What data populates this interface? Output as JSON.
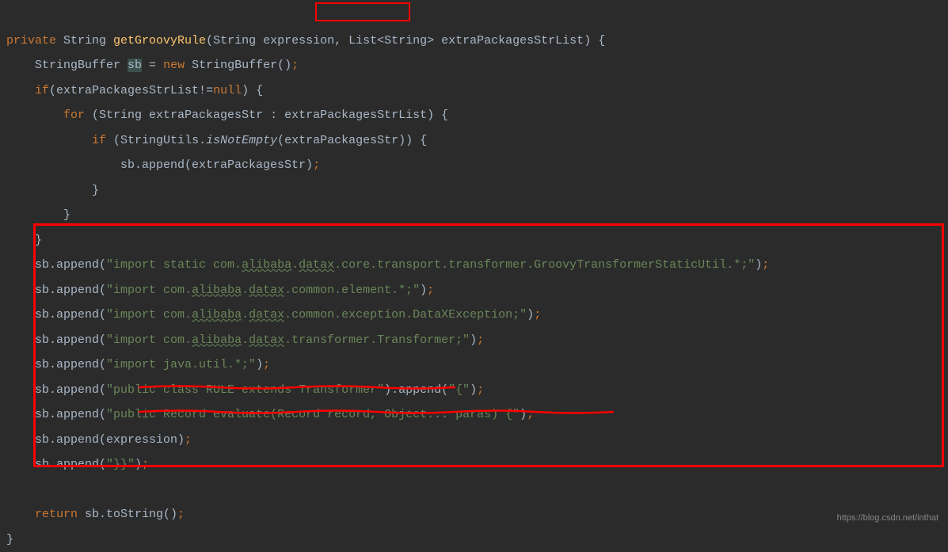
{
  "code": {
    "l1_private": "private",
    "l1_type1": " String ",
    "l1_method": "getGroovyRule",
    "l1_p1": "(",
    "l1_type2": "String ",
    "l1_param1": "expression",
    "l1_comma": ", ",
    "l1_type3": "List<String> extraPackagesStrList",
    "l1_p2": ") {",
    "l2_pre": "    StringBuffer ",
    "l2_var": "sb",
    "l2_eq": " = ",
    "l2_new": "new",
    "l2_post": " StringBuffer()",
    "l2_semi": ";",
    "l3_pre": "    ",
    "l3_if": "if",
    "l3_cond1": "(extraPackagesStrList!=",
    "l3_null": "null",
    "l3_cond2": ") {",
    "l4_pre": "        ",
    "l4_for": "for",
    "l4_post": " (String extraPackagesStr : extraPackagesStrList) {",
    "l5_pre": "            ",
    "l5_if": "if",
    "l5_p1": " (StringUtils.",
    "l5_method": "isNotEmpty",
    "l5_p2": "(extraPackagesStr)) {",
    "l6": "                sb.append(extraPackagesStr)",
    "l6_semi": ";",
    "l7": "            }",
    "l8": "        }",
    "l9": "    }",
    "l10_pre": "    sb.append(",
    "l10_s1": "\"import static com.",
    "l10_w1": "alibaba",
    "l10_s2": ".",
    "l10_w2": "datax",
    "l10_s3": ".core.transport.transformer.GroovyTransformerStaticUtil.*;\"",
    "l10_post": ")",
    "l10_semi": ";",
    "l11_pre": "    sb.append(",
    "l11_s1": "\"import com.",
    "l11_w1": "alibaba",
    "l11_s2": ".",
    "l11_w2": "datax",
    "l11_s3": ".common.element.*;\"",
    "l11_post": ")",
    "l11_semi": ";",
    "l12_pre": "    sb.append(",
    "l12_s1": "\"import com.",
    "l12_w1": "alibaba",
    "l12_s2": ".",
    "l12_w2": "datax",
    "l12_s3": ".common.exception.DataXException;\"",
    "l12_post": ")",
    "l12_semi": ";",
    "l13_pre": "    sb.append(",
    "l13_s1": "\"import com.",
    "l13_w1": "alibaba",
    "l13_s2": ".",
    "l13_w2": "datax",
    "l13_s3": ".transformer.Transformer;\"",
    "l13_post": ")",
    "l13_semi": ";",
    "l14_pre": "    sb.append(",
    "l14_s": "\"import java.util.*;\"",
    "l14_post": ")",
    "l14_semi": ";",
    "l15_pre": "    sb.append(",
    "l15_s1": "\"public class RULE extends Transformer\"",
    "l15_mid": ").append(",
    "l15_s2": "\"{\"",
    "l15_post": ")",
    "l15_semi": ";",
    "l16_pre": "    sb.append(",
    "l16_s": "\"public Record evaluate(Record record, Object... paras) {\"",
    "l16_post": ")",
    "l16_semi": ";",
    "l17": "    sb.append(expression)",
    "l17_semi": ";",
    "l18_pre": "    sb.append(",
    "l18_s": "\"}}\"",
    "l18_post": ")",
    "l18_semi": ";",
    "l19": "",
    "l20_pre": "    ",
    "l20_return": "return",
    "l20_post": " sb.toString()",
    "l20_semi": ";",
    "l21": "}"
  },
  "watermark": "https://blog.csdn.net/inthat"
}
